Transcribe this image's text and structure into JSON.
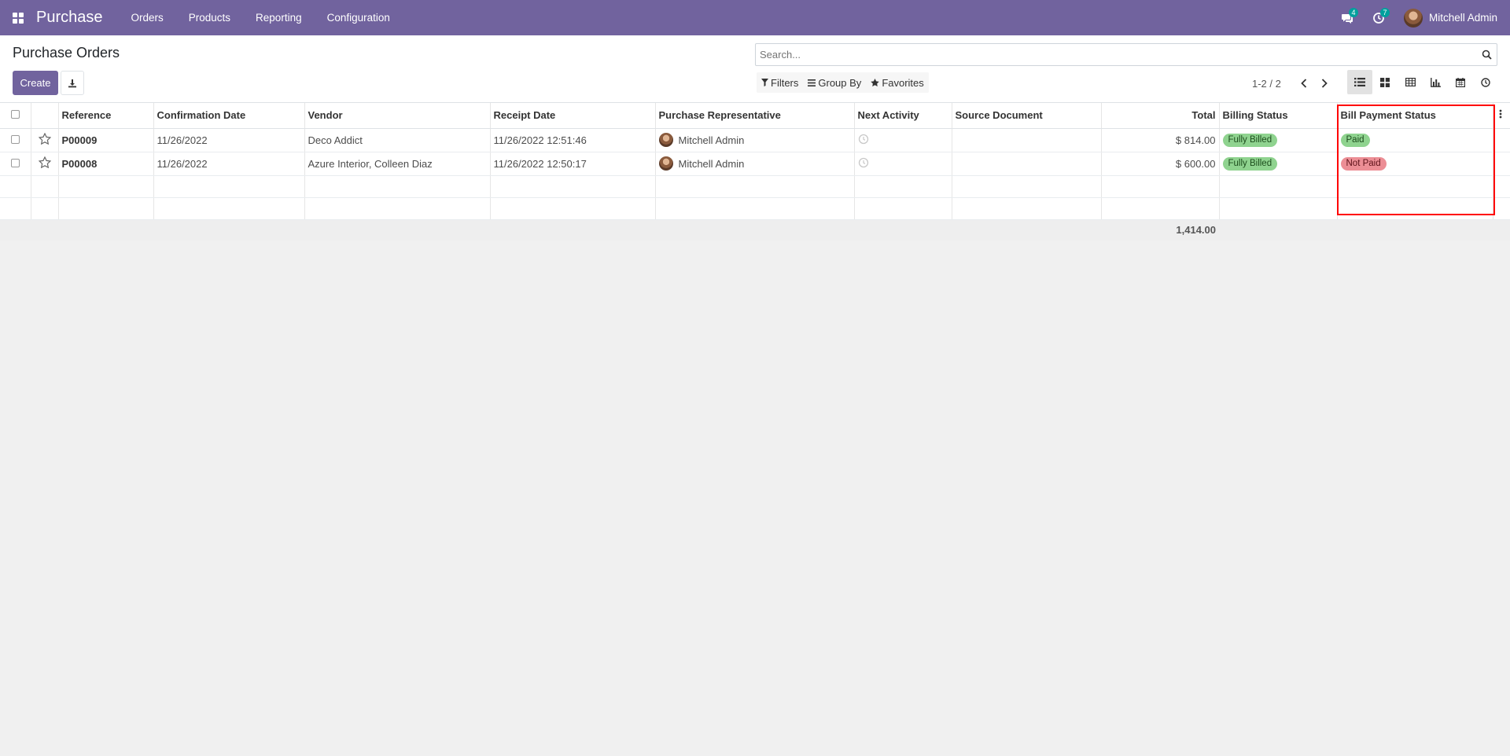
{
  "navbar": {
    "brand": "Purchase",
    "menu": [
      "Orders",
      "Products",
      "Reporting",
      "Configuration"
    ],
    "messages_count": "4",
    "activities_count": "7",
    "user_name": "Mitchell Admin"
  },
  "control_panel": {
    "title": "Purchase Orders",
    "create_label": "Create",
    "search_placeholder": "Search...",
    "filters_label": "Filters",
    "group_by_label": "Group By",
    "favorites_label": "Favorites",
    "pager_value": "1-2 / 2",
    "views": [
      "list-view",
      "kanban-view",
      "pivot-view",
      "graph-view",
      "calendar-view",
      "activity-view"
    ],
    "active_view": "list-view"
  },
  "table": {
    "columns": [
      "Reference",
      "Confirmation Date",
      "Vendor",
      "Receipt Date",
      "Purchase Representative",
      "Next Activity",
      "Source Document",
      "Total",
      "Billing Status",
      "Bill Payment Status"
    ],
    "rows": [
      {
        "reference": "P00009",
        "confirmation_date": "11/26/2022",
        "vendor": "Deco Addict",
        "receipt_date": "11/26/2022 12:51:46",
        "representative": "Mitchell Admin",
        "source_document": "",
        "total": "$ 814.00",
        "billing_status": "Fully Billed",
        "payment_status": "Paid"
      },
      {
        "reference": "P00008",
        "confirmation_date": "11/26/2022",
        "vendor": "Azure Interior, Colleen Diaz",
        "receipt_date": "11/26/2022 12:50:17",
        "representative": "Mitchell Admin",
        "source_document": "",
        "total": "$ 600.00",
        "billing_status": "Fully Billed",
        "payment_status": "Not Paid"
      }
    ],
    "footer_total": "1,414.00"
  },
  "colors": {
    "brand": "#71639e",
    "success_badge": "#8fd38f",
    "danger_badge": "#ec8e95",
    "highlight": "#ff0000"
  }
}
